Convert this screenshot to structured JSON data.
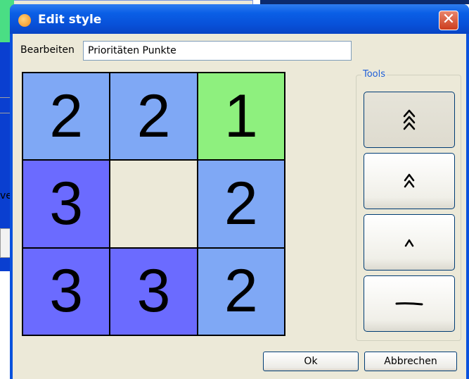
{
  "background": {
    "partial_text": "ve"
  },
  "dialog": {
    "title": "Edit style",
    "close_label": "✕",
    "edit_label": "Bearbeiten",
    "name_value": "Prioritäten Punkte",
    "tools_label": "Tools",
    "ok_label": "Ok",
    "cancel_label": "Abbrechen"
  },
  "grid": {
    "cells": [
      {
        "value": "2",
        "color": "#7fa8f5"
      },
      {
        "value": "2",
        "color": "#7fa8f5"
      },
      {
        "value": "1",
        "color": "#8ef07e"
      },
      {
        "value": "3",
        "color": "#6b6bff"
      },
      {
        "value": "",
        "color": "#ece9d8"
      },
      {
        "value": "2",
        "color": "#7fa8f5"
      },
      {
        "value": "3",
        "color": "#6b6bff"
      },
      {
        "value": "3",
        "color": "#6b6bff"
      },
      {
        "value": "2",
        "color": "#7fa8f5"
      }
    ]
  },
  "tools": [
    {
      "icon": "triple-chevron-up-icon",
      "active": true
    },
    {
      "icon": "double-chevron-up-icon",
      "active": false
    },
    {
      "icon": "single-chevron-up-icon",
      "active": false
    },
    {
      "icon": "dash-line-icon",
      "active": false
    }
  ]
}
